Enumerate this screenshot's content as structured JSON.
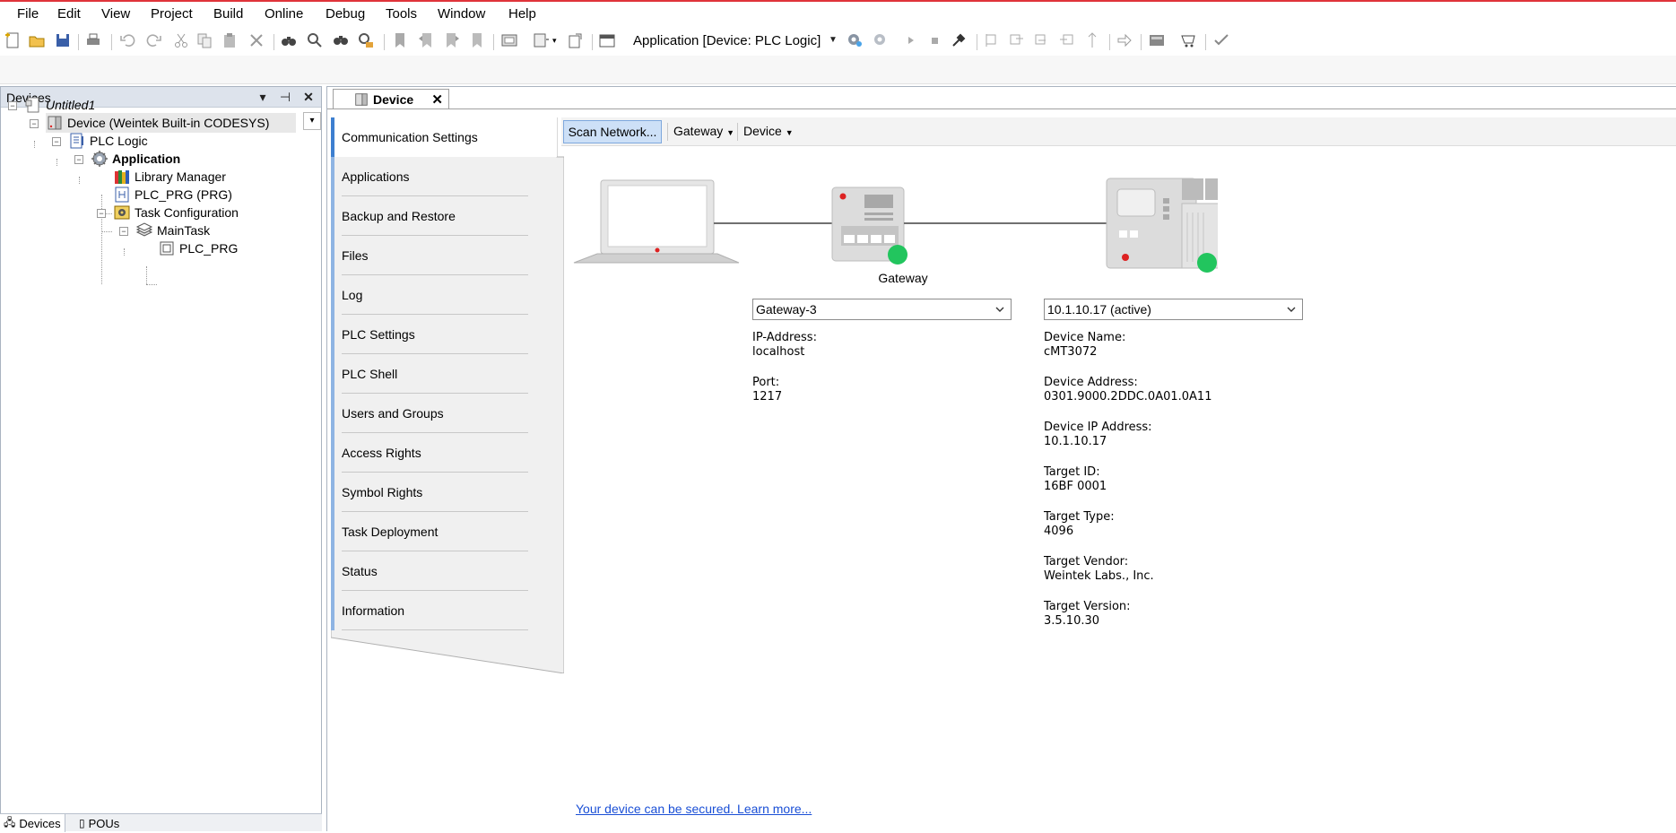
{
  "menu": [
    "File",
    "Edit",
    "View",
    "Project",
    "Build",
    "Online",
    "Debug",
    "Tools",
    "Window",
    "Help"
  ],
  "toolbar": {
    "active_application": "Application [Device: PLC Logic]"
  },
  "devices_panel": {
    "title": "Devices",
    "tree": [
      {
        "label": "Untitled1",
        "italic": true
      },
      {
        "label": "Device (Weintek Built-in CODESYS)",
        "selected": true
      },
      {
        "label": "PLC Logic"
      },
      {
        "label": "Application",
        "bold": true
      },
      {
        "label": "Library Manager"
      },
      {
        "label": "PLC_PRG (PRG)"
      },
      {
        "label": "Task Configuration"
      },
      {
        "label": "MainTask"
      },
      {
        "label": "PLC_PRG"
      }
    ],
    "bottom_tabs": [
      "Devices",
      "POUs"
    ]
  },
  "editor": {
    "tab_title": "Device",
    "side_tabs": [
      "Communication Settings",
      "Applications",
      "Backup and Restore",
      "Files",
      "Log",
      "PLC Settings",
      "PLC Shell",
      "Users and Groups",
      "Access Rights",
      "Symbol Rights",
      "Task Deployment",
      "Status",
      "Information"
    ],
    "content_toolbar": {
      "scan_label": "Scan Network...",
      "gateway_menu": "Gateway",
      "device_menu": "Device"
    },
    "gateway": {
      "label": "Gateway",
      "selected": "Gateway-3",
      "ip_label": "IP-Address:",
      "ip_value": "localhost",
      "port_label": "Port:",
      "port_value": "1217"
    },
    "device": {
      "selected": "10.1.10.17 (active)",
      "fields": [
        {
          "label": "Device Name:",
          "value": "cMT3072"
        },
        {
          "label": "Device Address:",
          "value": "0301.9000.2DDC.0A01.0A11"
        },
        {
          "label": "Device IP Address:",
          "value": "10.1.10.17"
        },
        {
          "label": "Target ID:",
          "value": "16BF 0001"
        },
        {
          "label": "Target Type:",
          "value": "4096"
        },
        {
          "label": "Target Vendor:",
          "value": "Weintek Labs., Inc."
        },
        {
          "label": "Target Version:",
          "value": "3.5.10.30"
        }
      ]
    },
    "secure_link": "Your device can be secured. Learn more..."
  },
  "colors": {
    "accent_blue": "#3d7fd0",
    "status_green": "#22c55e",
    "link": "#1a4fd6"
  }
}
